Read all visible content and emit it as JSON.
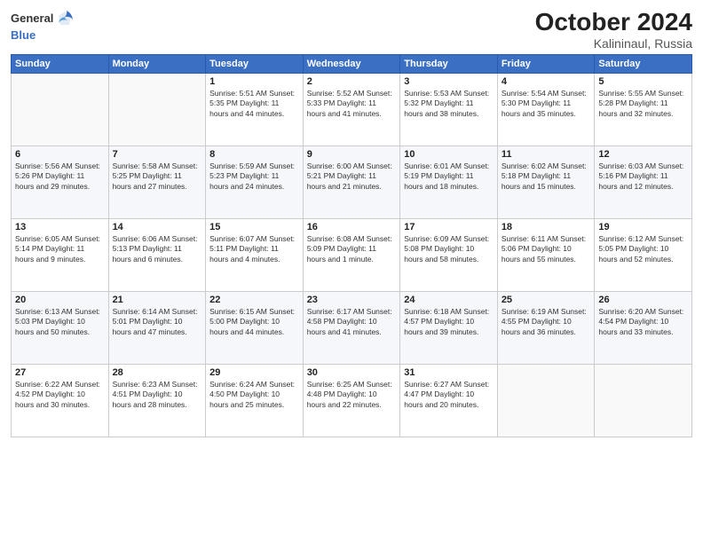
{
  "header": {
    "logo_general": "General",
    "logo_blue": "Blue",
    "month": "October 2024",
    "location": "Kalininaul, Russia"
  },
  "weekdays": [
    "Sunday",
    "Monday",
    "Tuesday",
    "Wednesday",
    "Thursday",
    "Friday",
    "Saturday"
  ],
  "weeks": [
    [
      {
        "day": "",
        "info": ""
      },
      {
        "day": "",
        "info": ""
      },
      {
        "day": "1",
        "info": "Sunrise: 5:51 AM\nSunset: 5:35 PM\nDaylight: 11 hours and 44 minutes."
      },
      {
        "day": "2",
        "info": "Sunrise: 5:52 AM\nSunset: 5:33 PM\nDaylight: 11 hours and 41 minutes."
      },
      {
        "day": "3",
        "info": "Sunrise: 5:53 AM\nSunset: 5:32 PM\nDaylight: 11 hours and 38 minutes."
      },
      {
        "day": "4",
        "info": "Sunrise: 5:54 AM\nSunset: 5:30 PM\nDaylight: 11 hours and 35 minutes."
      },
      {
        "day": "5",
        "info": "Sunrise: 5:55 AM\nSunset: 5:28 PM\nDaylight: 11 hours and 32 minutes."
      }
    ],
    [
      {
        "day": "6",
        "info": "Sunrise: 5:56 AM\nSunset: 5:26 PM\nDaylight: 11 hours and 29 minutes."
      },
      {
        "day": "7",
        "info": "Sunrise: 5:58 AM\nSunset: 5:25 PM\nDaylight: 11 hours and 27 minutes."
      },
      {
        "day": "8",
        "info": "Sunrise: 5:59 AM\nSunset: 5:23 PM\nDaylight: 11 hours and 24 minutes."
      },
      {
        "day": "9",
        "info": "Sunrise: 6:00 AM\nSunset: 5:21 PM\nDaylight: 11 hours and 21 minutes."
      },
      {
        "day": "10",
        "info": "Sunrise: 6:01 AM\nSunset: 5:19 PM\nDaylight: 11 hours and 18 minutes."
      },
      {
        "day": "11",
        "info": "Sunrise: 6:02 AM\nSunset: 5:18 PM\nDaylight: 11 hours and 15 minutes."
      },
      {
        "day": "12",
        "info": "Sunrise: 6:03 AM\nSunset: 5:16 PM\nDaylight: 11 hours and 12 minutes."
      }
    ],
    [
      {
        "day": "13",
        "info": "Sunrise: 6:05 AM\nSunset: 5:14 PM\nDaylight: 11 hours and 9 minutes."
      },
      {
        "day": "14",
        "info": "Sunrise: 6:06 AM\nSunset: 5:13 PM\nDaylight: 11 hours and 6 minutes."
      },
      {
        "day": "15",
        "info": "Sunrise: 6:07 AM\nSunset: 5:11 PM\nDaylight: 11 hours and 4 minutes."
      },
      {
        "day": "16",
        "info": "Sunrise: 6:08 AM\nSunset: 5:09 PM\nDaylight: 11 hours and 1 minute."
      },
      {
        "day": "17",
        "info": "Sunrise: 6:09 AM\nSunset: 5:08 PM\nDaylight: 10 hours and 58 minutes."
      },
      {
        "day": "18",
        "info": "Sunrise: 6:11 AM\nSunset: 5:06 PM\nDaylight: 10 hours and 55 minutes."
      },
      {
        "day": "19",
        "info": "Sunrise: 6:12 AM\nSunset: 5:05 PM\nDaylight: 10 hours and 52 minutes."
      }
    ],
    [
      {
        "day": "20",
        "info": "Sunrise: 6:13 AM\nSunset: 5:03 PM\nDaylight: 10 hours and 50 minutes."
      },
      {
        "day": "21",
        "info": "Sunrise: 6:14 AM\nSunset: 5:01 PM\nDaylight: 10 hours and 47 minutes."
      },
      {
        "day": "22",
        "info": "Sunrise: 6:15 AM\nSunset: 5:00 PM\nDaylight: 10 hours and 44 minutes."
      },
      {
        "day": "23",
        "info": "Sunrise: 6:17 AM\nSunset: 4:58 PM\nDaylight: 10 hours and 41 minutes."
      },
      {
        "day": "24",
        "info": "Sunrise: 6:18 AM\nSunset: 4:57 PM\nDaylight: 10 hours and 39 minutes."
      },
      {
        "day": "25",
        "info": "Sunrise: 6:19 AM\nSunset: 4:55 PM\nDaylight: 10 hours and 36 minutes."
      },
      {
        "day": "26",
        "info": "Sunrise: 6:20 AM\nSunset: 4:54 PM\nDaylight: 10 hours and 33 minutes."
      }
    ],
    [
      {
        "day": "27",
        "info": "Sunrise: 6:22 AM\nSunset: 4:52 PM\nDaylight: 10 hours and 30 minutes."
      },
      {
        "day": "28",
        "info": "Sunrise: 6:23 AM\nSunset: 4:51 PM\nDaylight: 10 hours and 28 minutes."
      },
      {
        "day": "29",
        "info": "Sunrise: 6:24 AM\nSunset: 4:50 PM\nDaylight: 10 hours and 25 minutes."
      },
      {
        "day": "30",
        "info": "Sunrise: 6:25 AM\nSunset: 4:48 PM\nDaylight: 10 hours and 22 minutes."
      },
      {
        "day": "31",
        "info": "Sunrise: 6:27 AM\nSunset: 4:47 PM\nDaylight: 10 hours and 20 minutes."
      },
      {
        "day": "",
        "info": ""
      },
      {
        "day": "",
        "info": ""
      }
    ]
  ]
}
